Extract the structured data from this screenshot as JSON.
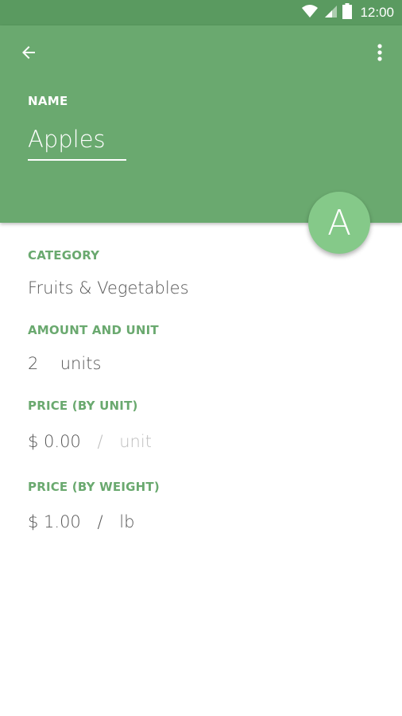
{
  "status_bar": {
    "time": "12:00"
  },
  "header": {
    "name_label": "NAME",
    "name_value": "Apples",
    "avatar_letter": "A"
  },
  "fields": {
    "category": {
      "label": "CATEGORY",
      "value": "Fruits & Vegetables"
    },
    "amount": {
      "label": "AMOUNT AND UNIT",
      "quantity": "2",
      "unit": "units"
    },
    "price_unit": {
      "label": "PRICE (BY UNIT)",
      "price": "$ 0.00",
      "slash": "/",
      "unit": "unit"
    },
    "price_weight": {
      "label": "PRICE (BY WEIGHT)",
      "price": "$ 1.00",
      "slash": "/",
      "unit": "lb"
    }
  },
  "icons": {
    "back": "arrow-back-icon",
    "menu": "more-vert-icon",
    "wifi": "wifi-icon",
    "signal": "signal-icon",
    "battery": "battery-icon"
  },
  "colors": {
    "status_bar": "#5a9a60",
    "header": "#6aa96f",
    "accent": "#6aa96f",
    "avatar": "#85c989"
  }
}
